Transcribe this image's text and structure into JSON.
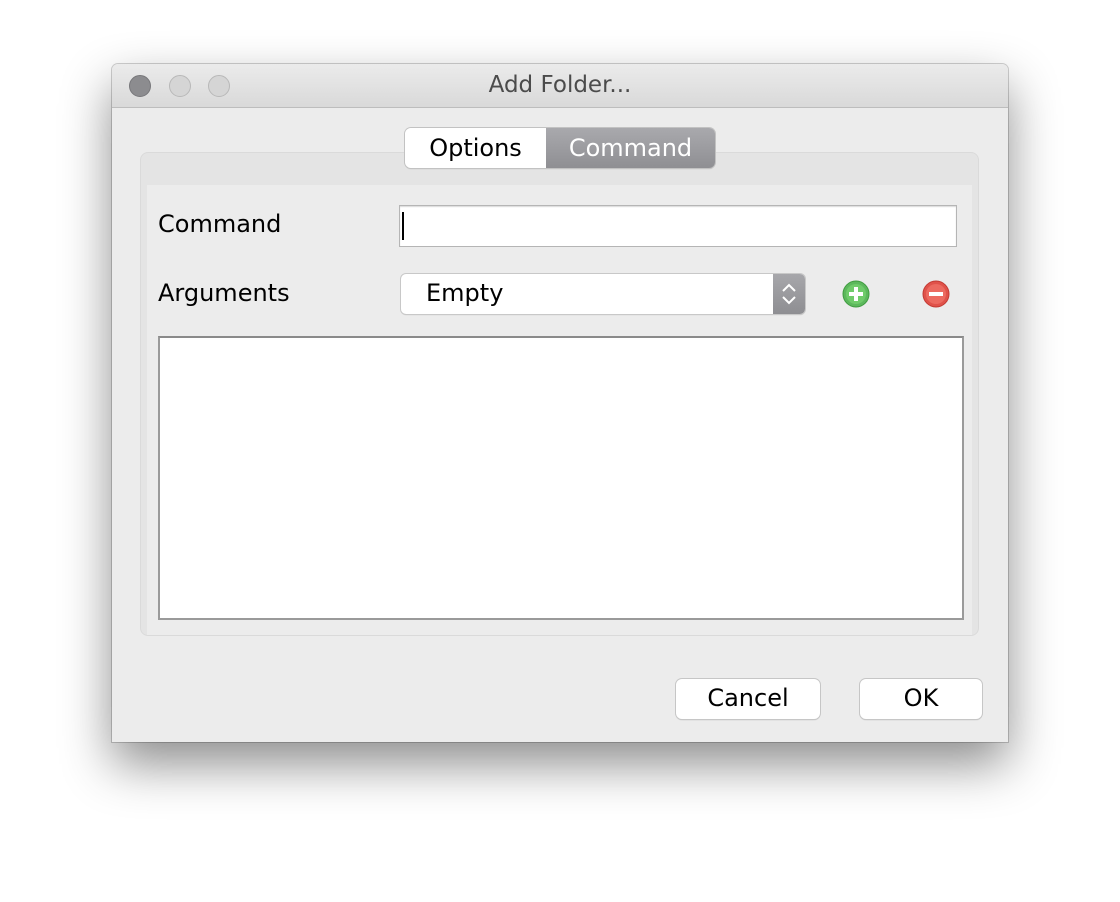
{
  "window": {
    "title": "Add Folder...",
    "controls": [
      "close",
      "minimize",
      "zoom"
    ]
  },
  "tabs": [
    {
      "label": "Options",
      "active": false
    },
    {
      "label": "Command",
      "active": true
    }
  ],
  "form": {
    "command_label": "Command",
    "command_value": "",
    "arguments_label": "Arguments",
    "arguments_selected": "Empty",
    "add_icon": "plus-circle-icon",
    "remove_icon": "minus-circle-icon",
    "arguments_list": []
  },
  "buttons": {
    "cancel": "Cancel",
    "ok": "OK"
  },
  "colors": {
    "add": "#5cb85c",
    "remove": "#e0524a",
    "active_tab": "#9a9a9e"
  }
}
